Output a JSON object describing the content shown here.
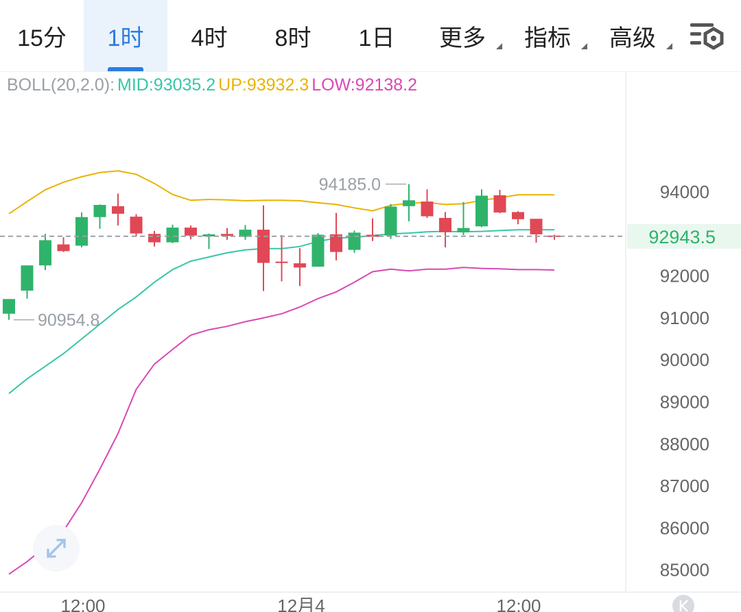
{
  "tabs": [
    {
      "label": "15分"
    },
    {
      "label": "1时",
      "active": true
    },
    {
      "label": "4时"
    },
    {
      "label": "8时"
    },
    {
      "label": "1日"
    },
    {
      "label": "更多",
      "dropdown": true
    },
    {
      "label": "指标",
      "dropdown": true
    },
    {
      "label": "高级",
      "dropdown": true
    }
  ],
  "settings_icon": "chart-settings-icon",
  "boll": {
    "name": "BOLL(20,2.0):",
    "mid": "MID:93035.2",
    "up": "UP:93932.3",
    "low": "LOW:92138.2"
  },
  "colors": {
    "up": "#2fb36b",
    "down": "#e04856",
    "mid": "#36c6a8",
    "upper": "#e8b400",
    "lower": "#d949b2",
    "accent": "#2b7de1",
    "price": "#2fb36b"
  },
  "chart_data": {
    "type": "candlestick",
    "yticks": [
      94000,
      92000,
      91000,
      90000,
      89000,
      88000,
      87000,
      86000,
      85000
    ],
    "xticks": [
      "12:00",
      "12月4",
      "12:00"
    ],
    "current_price": "92943.5",
    "high_label": "94185.0",
    "low_label": "90954.8",
    "candles": [
      {
        "o": 91100,
        "h": 91300,
        "l": 90955,
        "c": 91450
      },
      {
        "o": 91650,
        "h": 92250,
        "l": 91460,
        "c": 92250
      },
      {
        "o": 92250,
        "h": 93000,
        "l": 92140,
        "c": 92850
      },
      {
        "o": 92750,
        "h": 92920,
        "l": 92570,
        "c": 92590
      },
      {
        "o": 92720,
        "h": 93510,
        "l": 92680,
        "c": 93400
      },
      {
        "o": 93400,
        "h": 93700,
        "l": 93120,
        "c": 93690
      },
      {
        "o": 93660,
        "h": 93960,
        "l": 93200,
        "c": 93480
      },
      {
        "o": 93410,
        "h": 93470,
        "l": 92940,
        "c": 93010
      },
      {
        "o": 93000,
        "h": 93070,
        "l": 92700,
        "c": 92800
      },
      {
        "o": 92800,
        "h": 93220,
        "l": 92780,
        "c": 93150
      },
      {
        "o": 93150,
        "h": 93200,
        "l": 92870,
        "c": 92960
      },
      {
        "o": 92940,
        "h": 93010,
        "l": 92640,
        "c": 92990
      },
      {
        "o": 93000,
        "h": 93140,
        "l": 92860,
        "c": 92950
      },
      {
        "o": 92930,
        "h": 93210,
        "l": 92860,
        "c": 93100
      },
      {
        "o": 93100,
        "h": 93680,
        "l": 91640,
        "c": 92310
      },
      {
        "o": 92340,
        "h": 92970,
        "l": 91870,
        "c": 92330
      },
      {
        "o": 92300,
        "h": 92660,
        "l": 91760,
        "c": 92200
      },
      {
        "o": 92220,
        "h": 93020,
        "l": 92220,
        "c": 92980
      },
      {
        "o": 92990,
        "h": 93500,
        "l": 92370,
        "c": 92570
      },
      {
        "o": 92620,
        "h": 93080,
        "l": 92550,
        "c": 93030
      },
      {
        "o": 92980,
        "h": 93370,
        "l": 92830,
        "c": 92930
      },
      {
        "o": 92960,
        "h": 93710,
        "l": 92880,
        "c": 93650
      },
      {
        "o": 93660,
        "h": 94185,
        "l": 93300,
        "c": 93800
      },
      {
        "o": 93770,
        "h": 94060,
        "l": 93380,
        "c": 93420
      },
      {
        "o": 93380,
        "h": 93520,
        "l": 92680,
        "c": 93040
      },
      {
        "o": 93040,
        "h": 93760,
        "l": 92970,
        "c": 93140
      },
      {
        "o": 93180,
        "h": 94060,
        "l": 93160,
        "c": 93910
      },
      {
        "o": 93920,
        "h": 94050,
        "l": 93490,
        "c": 93510
      },
      {
        "o": 93520,
        "h": 93540,
        "l": 93230,
        "c": 93350
      },
      {
        "o": 93360,
        "h": 93340,
        "l": 92790,
        "c": 92990
      },
      {
        "o": 92960,
        "h": 92980,
        "l": 92860,
        "c": 92940
      }
    ],
    "boll_mid": [
      89200,
      89550,
      89850,
      90150,
      90500,
      90850,
      91200,
      91500,
      91850,
      92150,
      92350,
      92450,
      92550,
      92620,
      92650,
      92650,
      92700,
      92820,
      92900,
      92920,
      92960,
      93000,
      93020,
      93050,
      93060,
      93050,
      93060,
      93080,
      93100,
      93100,
      93100
    ],
    "boll_up": [
      93480,
      93770,
      94050,
      94230,
      94360,
      94460,
      94500,
      94420,
      94200,
      93940,
      93800,
      93820,
      93810,
      93790,
      93800,
      93800,
      93790,
      93740,
      93700,
      93620,
      93550,
      93680,
      93730,
      93750,
      93700,
      93720,
      93800,
      93860,
      93930,
      93930,
      93930
    ],
    "boll_low": [
      84900,
      85200,
      85550,
      85930,
      86600,
      87400,
      88250,
      89300,
      89900,
      90250,
      90590,
      90720,
      90800,
      90910,
      91000,
      91100,
      91260,
      91460,
      91620,
      91850,
      92100,
      92160,
      92120,
      92160,
      92160,
      92200,
      92180,
      92170,
      92150,
      92150,
      92140
    ]
  }
}
